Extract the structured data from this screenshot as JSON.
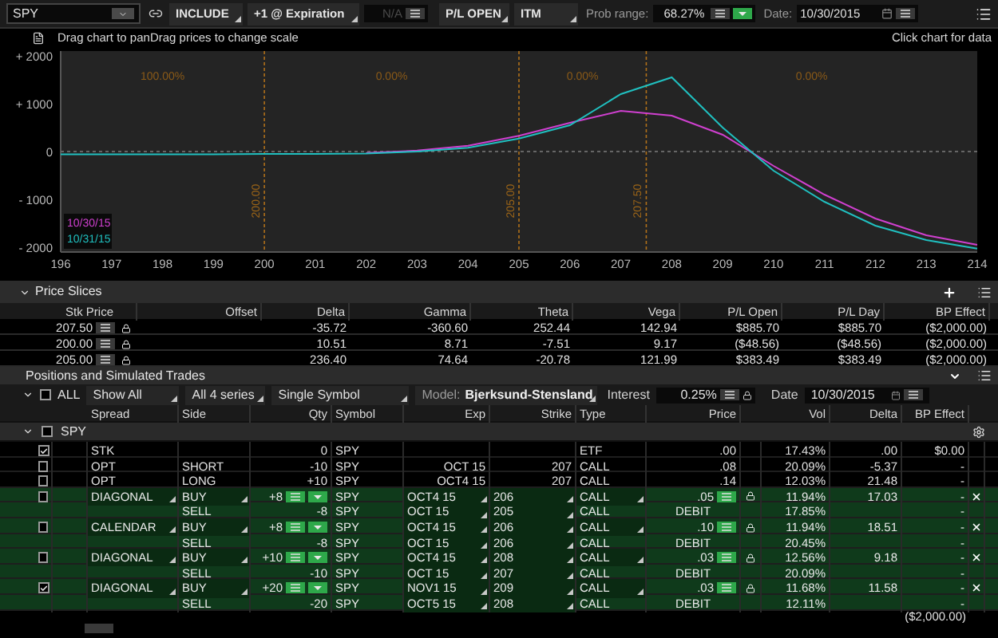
{
  "toolbar": {
    "symbol": "SPY",
    "include": "INCLUDE",
    "step": "+1 @ Expiration",
    "step_value": {
      "value": "N/A",
      "disabled": true
    },
    "pl_mode": "P/L OPEN",
    "itm": "ITM",
    "prob_label": "Prob range:",
    "prob_value": "68.27%",
    "date_label": "Date:",
    "date_value": "10/30/2015"
  },
  "chart_hint": {
    "left": "Drag chart to panDrag prices to change scale",
    "right": "Click chart for data"
  },
  "chart": {
    "chart_data": {
      "type": "line",
      "x": [
        196,
        197,
        198,
        199,
        200,
        201,
        202,
        203,
        204,
        205,
        206,
        207,
        208,
        209,
        210,
        211,
        212,
        213,
        214
      ],
      "xticks": [
        196,
        197,
        198,
        199,
        200,
        201,
        202,
        203,
        204,
        205,
        206,
        207,
        208,
        209,
        210,
        211,
        212,
        213,
        214
      ],
      "yticks": [
        {
          "value": 2000,
          "label": "+ 2000"
        },
        {
          "value": 1000,
          "label": "+ 1000"
        },
        {
          "value": 0,
          "label": "0"
        },
        {
          "value": -1000,
          "label": "- 1000"
        },
        {
          "value": -2000,
          "label": "- 2000"
        }
      ],
      "ylim": [
        -2100,
        2100
      ],
      "xlim": [
        196,
        214
      ],
      "series": [
        {
          "name": "10/30/15",
          "color": "#d040d0",
          "values": [
            null,
            null,
            null,
            null,
            null,
            null,
            -30,
            20,
            120,
            330,
            600,
            850,
            750,
            350,
            -300,
            -900,
            -1400,
            -1750,
            -1950
          ]
        },
        {
          "name": "10/31/15",
          "color": "#20c0c0",
          "values": [
            -60,
            -60,
            -60,
            -60,
            -50,
            -50,
            -40,
            0,
            80,
            270,
            550,
            1200,
            1550,
            500,
            -400,
            -1050,
            -1550,
            -1850,
            -2030
          ]
        }
      ],
      "ref_lines": [
        {
          "axis": "x",
          "value": 200,
          "label": "200.00"
        },
        {
          "axis": "x",
          "value": 205,
          "label": "205.00"
        },
        {
          "axis": "x",
          "value": 207.5,
          "label": "207.50"
        },
        {
          "axis": "y",
          "value": 0
        }
      ]
    },
    "probabilities": [
      "100.00%",
      "0.00%",
      "0.00%",
      "0.00%"
    ]
  },
  "price_slices": {
    "title": "Price Slices",
    "columns": [
      "Stk Price",
      "Offset",
      "Delta",
      "Gamma",
      "Theta",
      "Vega",
      "P/L Open",
      "P/L Day",
      "BP Effect"
    ],
    "rows": [
      {
        "stk_price": "207.50",
        "delta": "-35.72",
        "gamma": "-360.60",
        "theta": "252.44",
        "vega": "142.94",
        "pl_open": "$885.70",
        "pl_day": "$885.70",
        "bp_effect": "($2,000.00)"
      },
      {
        "stk_price": "200.00",
        "delta": "10.51",
        "gamma": "8.71",
        "theta": "-7.51",
        "vega": "9.17",
        "pl_open": "($48.56)",
        "pl_day": "($48.56)",
        "bp_effect": "($2,000.00)"
      },
      {
        "stk_price": "205.00",
        "delta": "236.40",
        "gamma": "74.64",
        "theta": "-20.78",
        "vega": "121.99",
        "pl_open": "$383.49",
        "pl_day": "$383.49",
        "bp_effect": "($2,000.00)"
      }
    ]
  },
  "positions": {
    "title": "Positions and Simulated Trades",
    "controls": {
      "all_label": "ALL",
      "all_checked": false,
      "show": "Show All",
      "series": "All 4 series",
      "symbol_mode": "Single Symbol",
      "model_label": "Model:",
      "model": "Bjerksund-Stensland",
      "interest_label": "Interest",
      "interest": "0.25%",
      "date_label": "Date",
      "date": "10/30/2015"
    },
    "columns": [
      "Spread",
      "Side",
      "Qty",
      "Symbol",
      "Exp",
      "Strike",
      "Type",
      "Price",
      "Vol",
      "Delta",
      "BP Effect"
    ],
    "group": {
      "label": "SPY",
      "checked": false,
      "expanded": true
    },
    "rows": [
      {
        "kind": "position",
        "checked": true,
        "spread": "STK",
        "qty": "0",
        "symbol": "SPY",
        "type": "ETF",
        "price": ".00",
        "vol": "17.43%",
        "delta": ".00",
        "bp_effect": "$0.00"
      },
      {
        "kind": "position",
        "checked": false,
        "spread": "OPT",
        "side": "SHORT",
        "qty": "-10",
        "symbol": "SPY",
        "exp": "OCT 15",
        "strike": "207",
        "type": "CALL",
        "price": ".08",
        "vol": "20.09%",
        "delta": "-5.37",
        "bp_effect": "-"
      },
      {
        "kind": "position",
        "checked": false,
        "spread": "OPT",
        "side": "LONG",
        "qty": "+10",
        "symbol": "SPY",
        "exp": "OCT4 15",
        "strike": "207",
        "type": "CALL",
        "price": ".14",
        "vol": "12.03%",
        "delta": "21.48",
        "bp_effect": "-"
      },
      {
        "kind": "trade",
        "checked": false,
        "spread": "DIAGONAL",
        "side": "BUY",
        "qty": "+8",
        "symbol": "SPY",
        "exp": "OCT4 15",
        "strike": "206",
        "type": "CALL",
        "price": ".05",
        "vol": "11.94%",
        "delta": "17.03",
        "bp_effect": "-"
      },
      {
        "kind": "leg",
        "side": "SELL",
        "qty": "-8",
        "symbol": "SPY",
        "exp": "OCT 15",
        "strike": "205",
        "type": "CALL",
        "price": "DEBIT",
        "vol": "17.85%",
        "bp_effect": "-"
      },
      {
        "kind": "trade",
        "checked": false,
        "spread": "CALENDAR",
        "side": "BUY",
        "qty": "+8",
        "symbol": "SPY",
        "exp": "OCT4 15",
        "strike": "206",
        "type": "CALL",
        "price": ".10",
        "vol": "11.94%",
        "delta": "18.51",
        "bp_effect": "-"
      },
      {
        "kind": "leg",
        "side": "SELL",
        "qty": "-8",
        "symbol": "SPY",
        "exp": "OCT 15",
        "strike": "206",
        "type": "CALL",
        "price": "DEBIT",
        "vol": "20.45%",
        "bp_effect": "-"
      },
      {
        "kind": "trade",
        "checked": false,
        "spread": "DIAGONAL",
        "side": "BUY",
        "qty": "+10",
        "symbol": "SPY",
        "exp": "OCT4 15",
        "strike": "208",
        "type": "CALL",
        "price": ".03",
        "vol": "12.56%",
        "delta": "9.18",
        "bp_effect": "-"
      },
      {
        "kind": "leg",
        "side": "SELL",
        "qty": "-10",
        "symbol": "SPY",
        "exp": "OCT 15",
        "strike": "207",
        "type": "CALL",
        "price": "DEBIT",
        "vol": "20.09%",
        "bp_effect": "-"
      },
      {
        "kind": "trade",
        "checked": true,
        "spread": "DIAGONAL",
        "side": "BUY",
        "qty": "+20",
        "symbol": "SPY",
        "exp": "NOV1 15",
        "strike": "209",
        "type": "CALL",
        "price": ".03",
        "vol": "11.68%",
        "delta": "11.58",
        "bp_effect": "-"
      },
      {
        "kind": "leg",
        "side": "SELL",
        "qty": "-20",
        "symbol": "SPY",
        "exp": "OCT5 15",
        "strike": "208",
        "type": "CALL",
        "price": "DEBIT",
        "vol": "12.11%",
        "bp_effect": "-"
      }
    ],
    "total_bp_effect": "($2,000.00)"
  }
}
